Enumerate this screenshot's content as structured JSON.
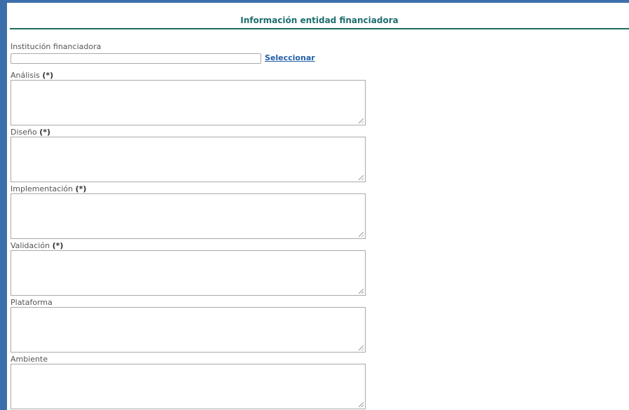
{
  "header": {
    "title": "Información entidad financiadora"
  },
  "institution": {
    "label": "Institución financiadora",
    "value": "",
    "select_link": "Seleccionar"
  },
  "required_marker": "(*)",
  "fields": [
    {
      "label": "Análisis",
      "required": true,
      "value": ""
    },
    {
      "label": "Diseño",
      "required": true,
      "value": ""
    },
    {
      "label": "Implementación",
      "required": true,
      "value": ""
    },
    {
      "label": "Validación",
      "required": true,
      "value": ""
    },
    {
      "label": "Plataforma",
      "required": false,
      "value": ""
    },
    {
      "label": "Ambiente",
      "required": false,
      "value": ""
    }
  ]
}
